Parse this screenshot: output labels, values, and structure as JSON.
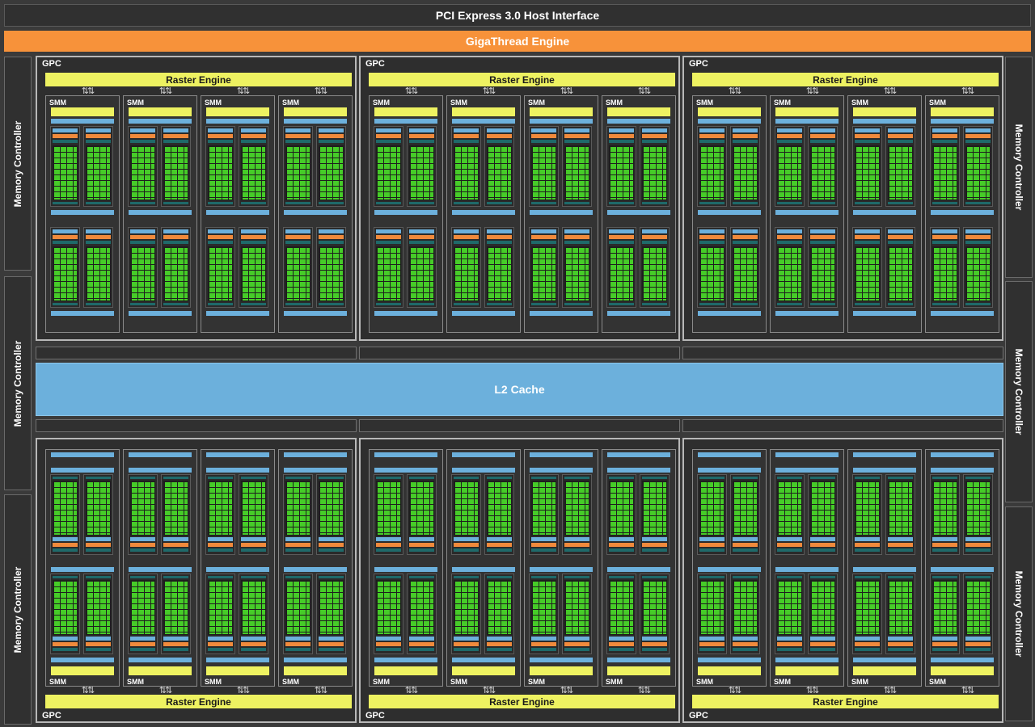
{
  "host_interface": "PCI Express 3.0 Host Interface",
  "giga_thread": "GigaThread Engine",
  "memory_controller_label": "Memory Controller",
  "l2_cache": "L2 Cache",
  "gpc_label": "GPC",
  "raster_label": "Raster Engine",
  "smm_label": "SMM",
  "arrow_glyph": "⇅⇅",
  "colors": {
    "background": "#3a3a3a",
    "giga_thread": "#f7923a",
    "raster_engine": "#eef261",
    "l2_cache": "#6cb0dc",
    "cuda_core": "#46cc28",
    "load_store_unit": "#2060b0",
    "dispatch_unit": "#f08a3c"
  },
  "layout": {
    "gpc_count": 6,
    "smm_per_gpc": 4,
    "memory_controllers_per_side": 3
  }
}
